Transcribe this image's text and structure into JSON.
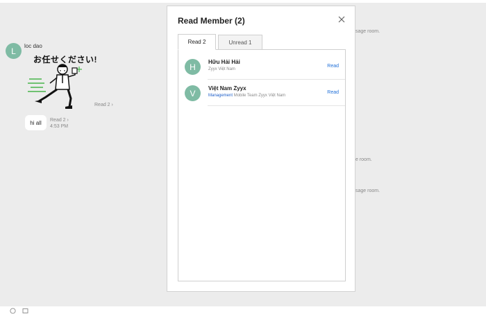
{
  "chat": {
    "sender_initial": "L",
    "sender_name": "loc dao",
    "sticker_text": "お任せください!",
    "sticker_read": "Read 2 ›",
    "message_text": "hi all",
    "message_read": "Read 2 ›",
    "message_time": "4:53 PM",
    "right_texts": [
      "sage room.",
      "e room.",
      "sage room."
    ]
  },
  "modal": {
    "title": "Read Member (2)",
    "tabs": [
      {
        "label": "Read 2",
        "active": true
      },
      {
        "label": "Unread 1",
        "active": false
      }
    ],
    "members": [
      {
        "initial": "H",
        "name": "Hữu Hải Hải",
        "dept": "",
        "sub": "Zyyx Việt Nam",
        "status": "Read"
      },
      {
        "initial": "V",
        "name": "Việt Nam Zyyx",
        "dept": "Management",
        "sub": " Mobile Team  Zyyx Việt Nam",
        "status": "Read"
      }
    ]
  },
  "colors": {
    "avatar": "#7fbba4",
    "link": "#1f6fd8",
    "background": "#ececec"
  },
  "icons": [
    "close-icon",
    "emoji-icon",
    "image-icon"
  ]
}
